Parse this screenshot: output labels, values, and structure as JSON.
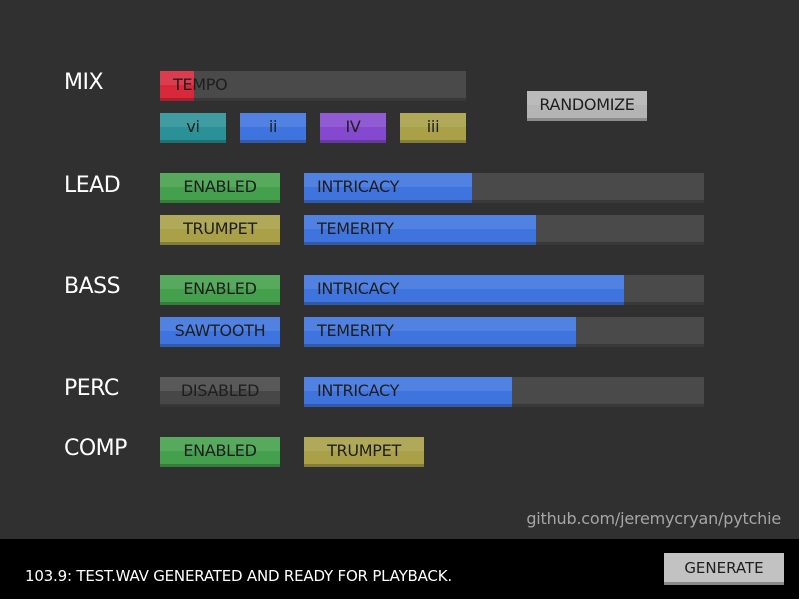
{
  "sections": {
    "mix": "MIX",
    "lead": "LEAD",
    "bass": "BASS",
    "perc": "PERC",
    "comp": "COMP"
  },
  "mix": {
    "tempo": {
      "label": "TEMPO",
      "value": 0.11,
      "color": "#d8283a"
    },
    "chords": [
      {
        "label": "vi",
        "color": "#2a9196"
      },
      {
        "label": "ii",
        "color": "#3f74de"
      },
      {
        "label": "IV",
        "color": "#8549cf"
      },
      {
        "label": "iii",
        "color": "#a9a048"
      }
    ],
    "randomize_label": "RANDOMIZE"
  },
  "lead": {
    "enabled_label": "ENABLED",
    "instrument_label": "TRUMPET",
    "intricacy": {
      "label": "INTRICACY",
      "value": 0.42
    },
    "temerity": {
      "label": "TEMERITY",
      "value": 0.58
    }
  },
  "bass": {
    "enabled_label": "ENABLED",
    "instrument_label": "SAWTOOTH",
    "intricacy": {
      "label": "INTRICACY",
      "value": 0.8
    },
    "temerity": {
      "label": "TEMERITY",
      "value": 0.68
    }
  },
  "perc": {
    "enabled_label": "DISABLED",
    "intricacy": {
      "label": "INTRICACY",
      "value": 0.52
    }
  },
  "comp": {
    "enabled_label": "ENABLED",
    "instrument_label": "TRUMPET"
  },
  "link_text": "github.com/jeremycryan/pytchie",
  "status_text": "103.9: TEST.WAV GENERATED AND READY FOR PLAYBACK.",
  "generate_label": "GENERATE"
}
